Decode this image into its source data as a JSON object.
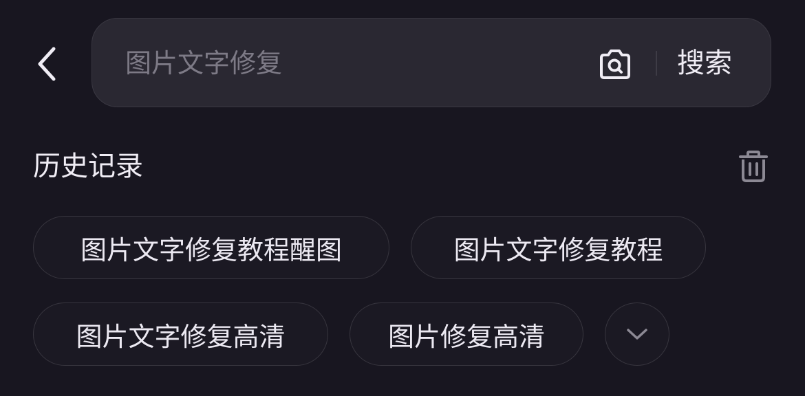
{
  "header": {
    "back_icon": "chevron-left-icon",
    "search": {
      "placeholder": "图片文字修复",
      "value": "",
      "camera_icon": "camera-icon",
      "search_label": "搜索"
    }
  },
  "history": {
    "title": "历史记录",
    "clear_icon": "trash-icon",
    "items": [
      {
        "label": "图片文字修复教程醒图"
      },
      {
        "label": "图片文字修复教程"
      },
      {
        "label": "图片文字修复高清"
      },
      {
        "label": "图片修复高清"
      }
    ],
    "expand_icon": "chevron-down-icon"
  },
  "colors": {
    "background": "#181620",
    "search_bar": "#2a2832",
    "chip_border": "#38363f",
    "text_primary": "#ece9f2",
    "placeholder": "#7d7a86",
    "icon_muted": "#8c8994"
  }
}
